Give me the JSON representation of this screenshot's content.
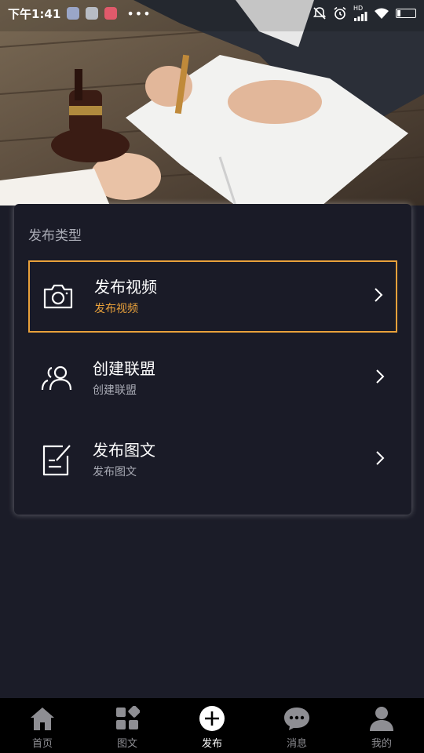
{
  "status_bar": {
    "time": "下午1:41",
    "dots": "•••",
    "network": "HD",
    "battery_level": 0.2
  },
  "card": {
    "title": "发布类型",
    "options": [
      {
        "title": "发布视频",
        "subtitle": "发布视频",
        "icon": "camera-icon",
        "selected": true
      },
      {
        "title": "创建联盟",
        "subtitle": "创建联盟",
        "icon": "users-icon",
        "selected": false
      },
      {
        "title": "发布图文",
        "subtitle": "发布图文",
        "icon": "edit-document-icon",
        "selected": false
      }
    ]
  },
  "bottom_nav": {
    "items": [
      {
        "label": "首页",
        "icon": "home-icon"
      },
      {
        "label": "图文",
        "icon": "grid-icon"
      },
      {
        "label": "发布",
        "icon": "plus-circle-icon",
        "active": true
      },
      {
        "label": "消息",
        "icon": "chat-icon"
      },
      {
        "label": "我的",
        "icon": "person-icon"
      }
    ]
  },
  "colors": {
    "accent": "#e9a13b",
    "background": "#1b1c28",
    "card": "#1a1b27",
    "nav_background": "#000000"
  }
}
